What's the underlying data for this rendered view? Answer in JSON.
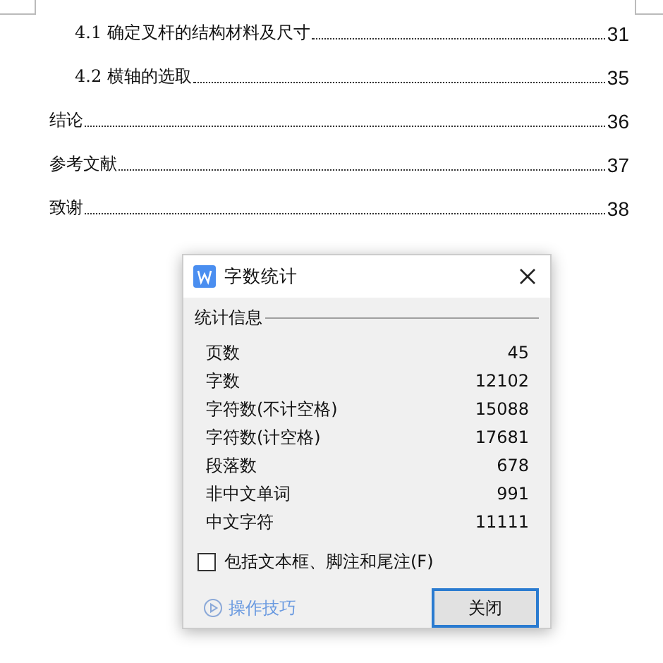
{
  "toc": [
    {
      "title": "4.1 确定叉杆的结构材料及尺寸",
      "page": "31",
      "kind": "section"
    },
    {
      "title": "4.2 横轴的选取",
      "page": "35",
      "kind": "section"
    },
    {
      "title": "结论",
      "page": "36",
      "kind": "chapter"
    },
    {
      "title": "参考文献",
      "page": "37",
      "kind": "chapter"
    },
    {
      "title": "致谢",
      "page": "38",
      "kind": "chapter"
    }
  ],
  "dialog": {
    "title": "字数统计",
    "group_label": "统计信息",
    "stats": [
      {
        "label": "页数",
        "value": "45"
      },
      {
        "label": "字数",
        "value": "12102"
      },
      {
        "label": "字符数(不计空格)",
        "value": "15088"
      },
      {
        "label": "字符数(计空格)",
        "value": "17681"
      },
      {
        "label": "段落数",
        "value": "678"
      },
      {
        "label": "非中文单词",
        "value": "991"
      },
      {
        "label": "中文字符",
        "value": "11111"
      }
    ],
    "checkbox": {
      "label": "包括文本框、脚注和尾注(F)",
      "checked": false
    },
    "tips_link": "操作技巧",
    "close_button": "关闭"
  }
}
